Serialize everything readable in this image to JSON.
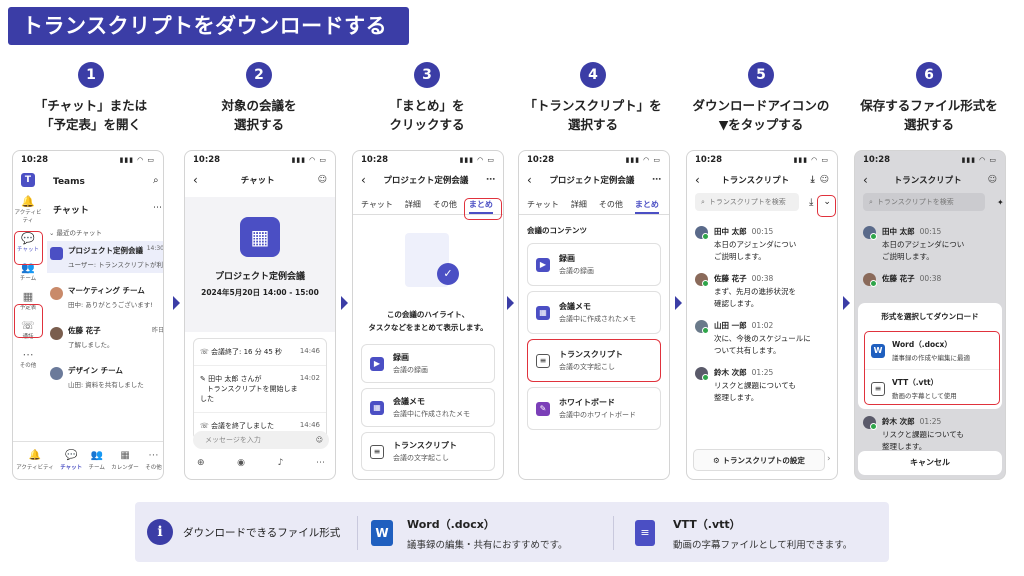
{
  "banner": "トランスクリプトをダウンロードする",
  "steps": [
    {
      "num": "1",
      "line1": "「チャット」または",
      "line2": "「予定表」を開く"
    },
    {
      "num": "2",
      "line1": "対象の会議を",
      "line2": "選択する"
    },
    {
      "num": "3",
      "line1": "「まとめ」を",
      "line2": "クリックする"
    },
    {
      "num": "4",
      "line1": "「トランスクリプト」を",
      "line2": "選択する"
    },
    {
      "num": "5",
      "line1": "ダウンロードアイコンの",
      "line2": "▼をタップする"
    },
    {
      "num": "6",
      "line1": "保存するファイル形式を",
      "line2": "選択する"
    }
  ],
  "time": "10:28",
  "p1": {
    "app": "Teams",
    "section": "チャット",
    "recent": "最近のチャット",
    "rail": [
      "アクティビティ",
      "チャット",
      "チーム",
      "予定表",
      "通話",
      "その他"
    ],
    "chats": [
      {
        "name": "プロジェクト定例会議",
        "time": "14:30",
        "sub": "ユーザー: トランスクリプトが利用..."
      },
      {
        "name": "マーケティング チーム",
        "time": "",
        "sub": "田中: ありがとうございます!"
      },
      {
        "name": "佐藤 花子",
        "time": "昨日",
        "sub": "了解しました。"
      },
      {
        "name": "デザイン チーム",
        "time": "",
        "sub": "山田: 資料を共有しました"
      }
    ],
    "nav": [
      "アクティビティ",
      "チャット",
      "チーム",
      "カレンダー",
      "その他"
    ]
  },
  "p2": {
    "title": "チャット",
    "meeting": "プロジェクト定例会議",
    "date": "2024年5月20日 14:00 - 15:00",
    "events": [
      {
        "text": "会議終了: 16 分 45 秒",
        "time": "14:46"
      },
      {
        "text": "田中 太郎 さんが",
        "text2": "トランスクリプトを開始しました",
        "time": "14:02"
      },
      {
        "text": "会議を終了しました",
        "time": "14:46"
      }
    ],
    "placeholder": "メッセージを入力"
  },
  "p3": {
    "title": "プロジェクト定例会議",
    "tabs": [
      "チャット",
      "詳細",
      "その他",
      "まとめ"
    ],
    "hl1": "この会議のハイライト、",
    "hl2": "タスクなどをまとめて表示します。",
    "cards": [
      {
        "t": "録画",
        "s": "会議の録画"
      },
      {
        "t": "会議メモ",
        "s": "会議中に作成されたメモ"
      },
      {
        "t": "トランスクリプト",
        "s": "会議の文字起こし"
      }
    ]
  },
  "p4": {
    "title": "プロジェクト定例会議",
    "tabs": [
      "チャット",
      "詳細",
      "その他",
      "まとめ"
    ],
    "section": "会議のコンテンツ",
    "cards": [
      {
        "t": "録画",
        "s": "会議の録画"
      },
      {
        "t": "会議メモ",
        "s": "会議中に作成されたメモ"
      },
      {
        "t": "トランスクリプト",
        "s": "会議の文字起こし"
      },
      {
        "t": "ホワイトボード",
        "s": "会議中のホワイトボード"
      }
    ]
  },
  "p5": {
    "title": "トランスクリプト",
    "search": "トランスクリプトを検索",
    "msgs": [
      {
        "name": "田中 太郎",
        "time": "00:15",
        "l1": "本日のアジェンダについ",
        "l2": "ご説明します。"
      },
      {
        "name": "佐藤 花子",
        "time": "00:38",
        "l1": "まず、先月の進捗状況を",
        "l2": "確認します。"
      },
      {
        "name": "山田 一郎",
        "time": "01:02",
        "l1": "次に、今後のスケジュールに",
        "l2": "ついて共有します。"
      },
      {
        "name": "鈴木 次郎",
        "time": "01:25",
        "l1": "リスクと課題についても",
        "l2": "整理します。"
      }
    ],
    "settings": "トランスクリプトの設定"
  },
  "p6": {
    "title": "トランスクリプト",
    "search": "トランスクリプトを検索",
    "msgs": [
      {
        "name": "田中 太郎",
        "time": "00:15",
        "l1": "本日のアジェンダについ",
        "l2": "ご説明します。"
      },
      {
        "name": "佐藤 花子",
        "time": "00:38"
      },
      {
        "name": "鈴木 次郎",
        "time": "01:25",
        "l1": "リスクと課題についても",
        "l2": "整理します。"
      }
    ],
    "sheet": "形式を選択してダウンロード",
    "opts": [
      {
        "t": "Word（.docx）",
        "s": "議事録の作成や編集に最適"
      },
      {
        "t": "VTT（.vtt）",
        "s": "動画の字幕として使用"
      }
    ],
    "cancel": "キャンセル"
  },
  "info": {
    "label": "ダウンロードできるファイル形式",
    "word_t": "Word（.docx）",
    "word_s": "議事録の編集・共有におすすめです。",
    "vtt_t": "VTT（.vtt）",
    "vtt_s": "動画の字幕ファイルとして利用できます。"
  },
  "colors": {
    "accent": "#3b3da6",
    "teams": "#4b4fc4",
    "highlight": "#e0323c"
  }
}
